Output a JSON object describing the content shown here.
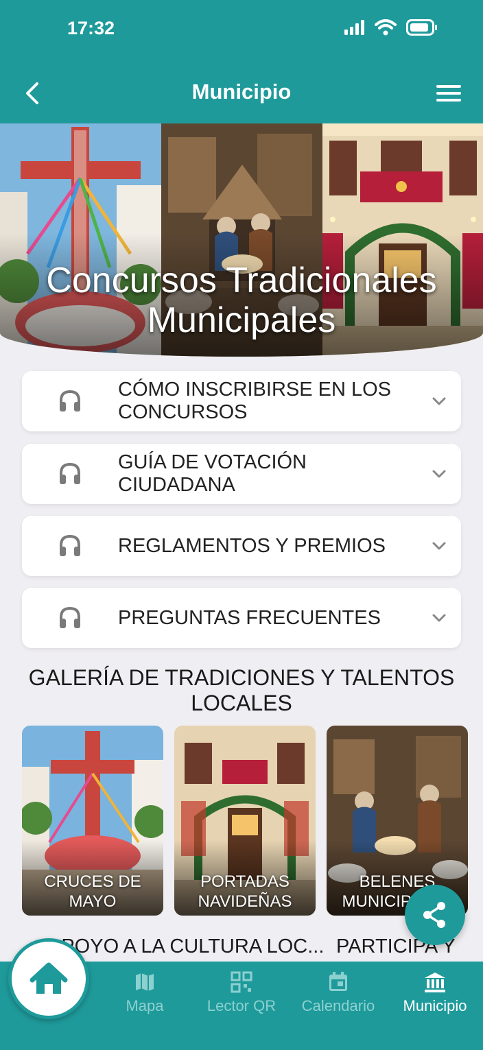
{
  "status": {
    "time": "17:32"
  },
  "nav": {
    "title": "Municipio"
  },
  "hero": {
    "title": "Concursos Tradicionales Municipales"
  },
  "accordions": [
    {
      "label": "CÓMO INSCRIBIRSE EN LOS CONCURSOS"
    },
    {
      "label": "GUÍA DE VOTACIÓN CIUDADANA"
    },
    {
      "label": "REGLAMENTOS Y PREMIOS"
    },
    {
      "label": "PREGUNTAS FRECUENTES"
    }
  ],
  "gallery": {
    "title": "GALERÍA DE TRADICIONES Y TALENTOS LOCALES",
    "cards": [
      {
        "label": "CRUCES DE MAYO"
      },
      {
        "label": "PORTADAS NAVIDEÑAS"
      },
      {
        "label": "BELENES MUNICIPALES"
      }
    ]
  },
  "sections": {
    "left": "APOYO A LA CULTURA LOC...",
    "right": "PARTICIPA Y"
  },
  "tabs": [
    {
      "label": "Mapa"
    },
    {
      "label": "Lector QR"
    },
    {
      "label": "Calendario"
    },
    {
      "label": "Municipio"
    }
  ],
  "colors": {
    "primary": "#1f9a9b",
    "background": "#efeef2"
  }
}
